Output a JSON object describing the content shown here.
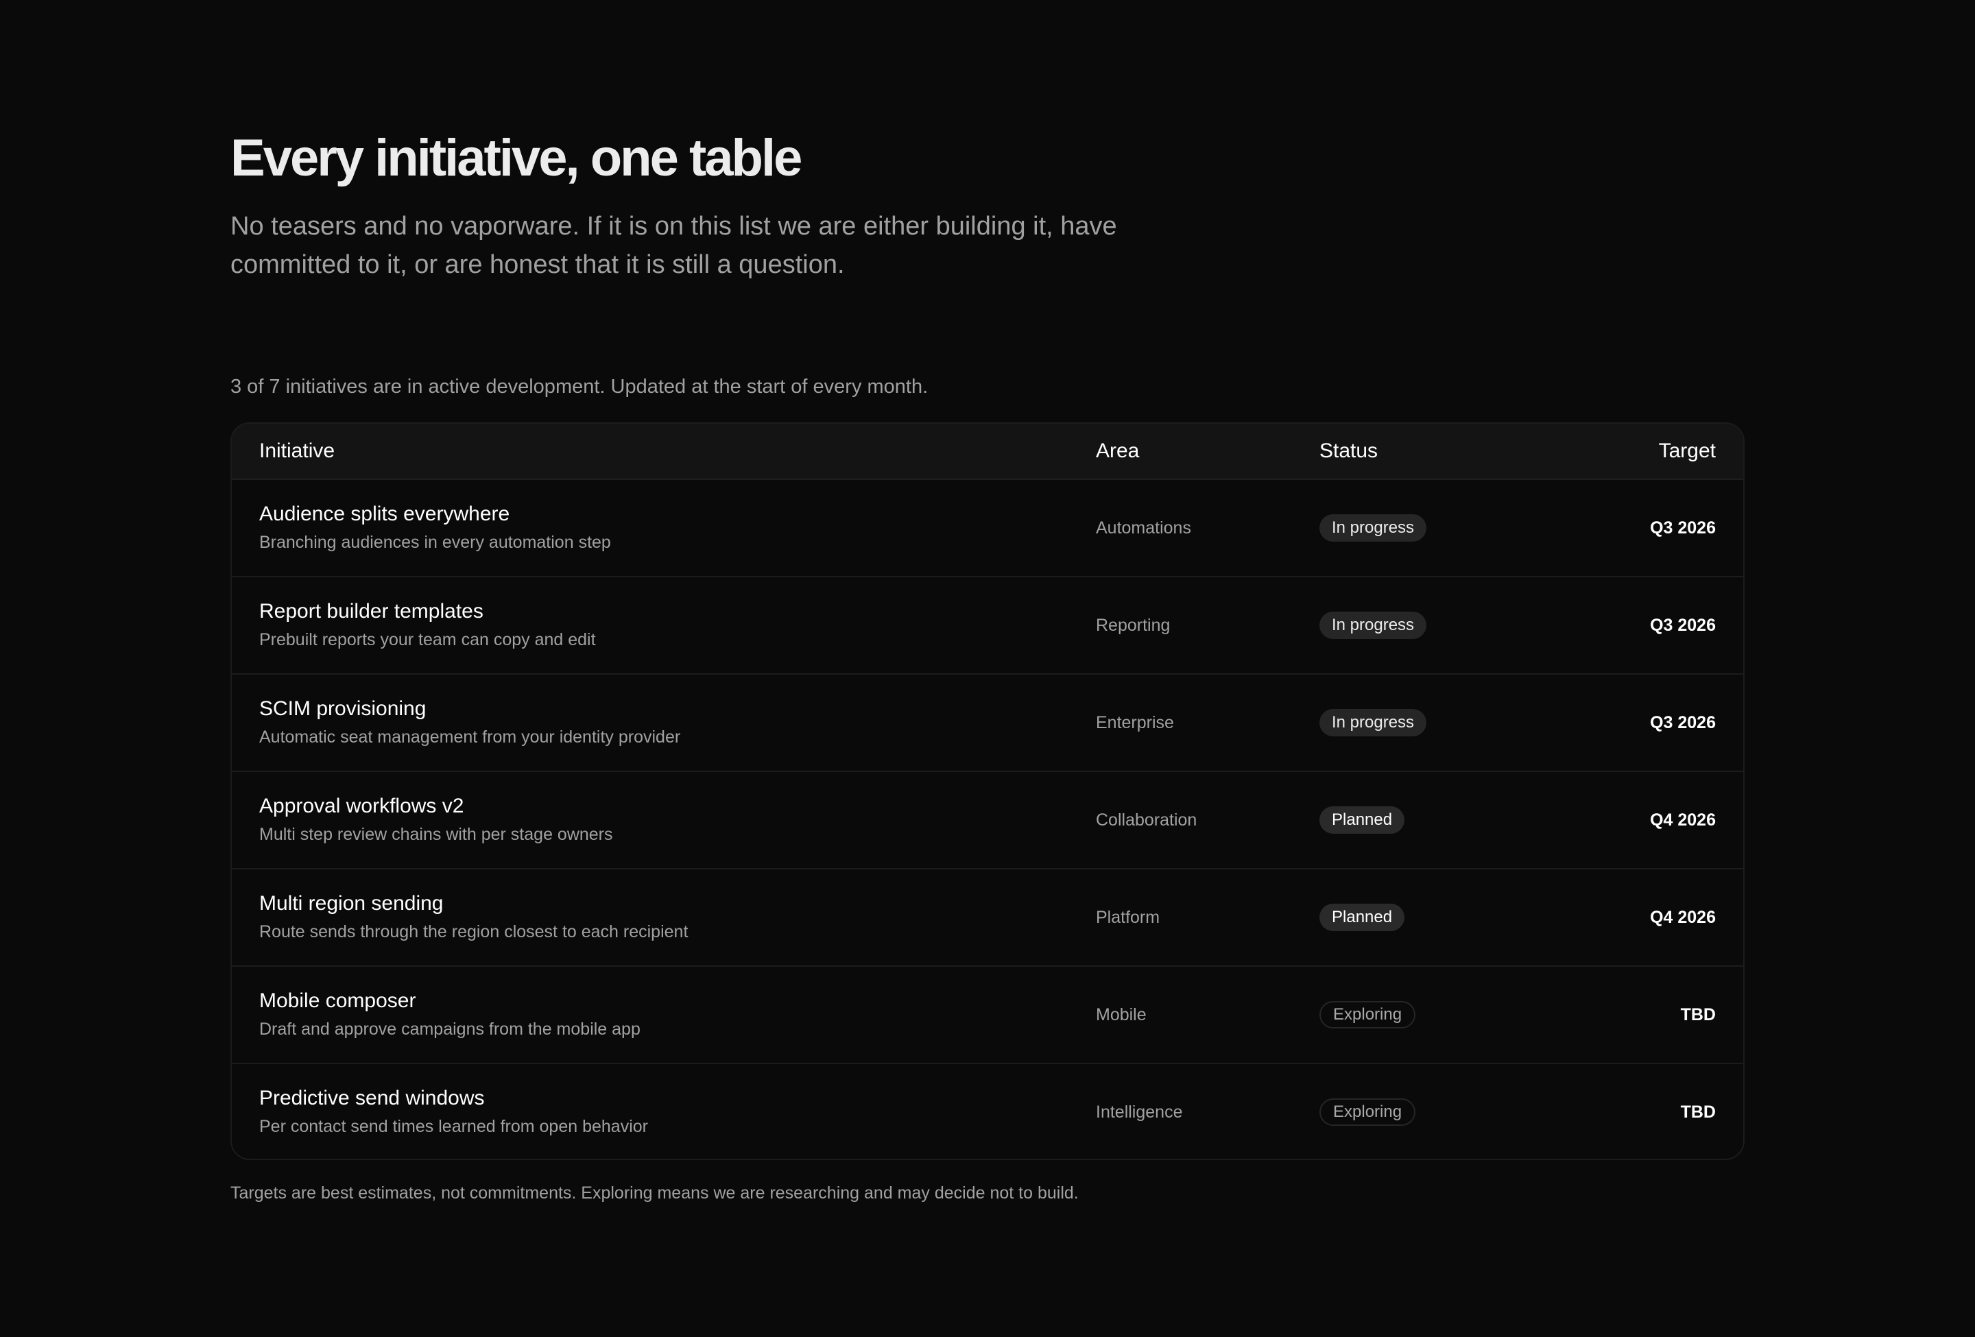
{
  "header": {
    "title": "Every initiative, one table",
    "subtitle": "No teasers and no vaporware. If it is on this list we are either building it, have committed to it, or are honest that it is still a question."
  },
  "summary": "3 of 7 initiatives are in active development. Updated at the start of every month.",
  "table": {
    "columns": {
      "initiative": "Initiative",
      "area": "Area",
      "status": "Status",
      "target": "Target"
    },
    "rows": [
      {
        "name": "Audience splits everywhere",
        "description": "Branching audiences in every automation step",
        "area": "Automations",
        "status": "In progress",
        "status_key": "in-progress",
        "target": "Q3 2026"
      },
      {
        "name": "Report builder templates",
        "description": "Prebuilt reports your team can copy and edit",
        "area": "Reporting",
        "status": "In progress",
        "status_key": "in-progress",
        "target": "Q3 2026"
      },
      {
        "name": "SCIM provisioning",
        "description": "Automatic seat management from your identity provider",
        "area": "Enterprise",
        "status": "In progress",
        "status_key": "in-progress",
        "target": "Q3 2026"
      },
      {
        "name": "Approval workflows v2",
        "description": "Multi step review chains with per stage owners",
        "area": "Collaboration",
        "status": "Planned",
        "status_key": "planned",
        "target": "Q4 2026"
      },
      {
        "name": "Multi region sending",
        "description": "Route sends through the region closest to each recipient",
        "area": "Platform",
        "status": "Planned",
        "status_key": "planned",
        "target": "Q4 2026"
      },
      {
        "name": "Mobile composer",
        "description": "Draft and approve campaigns from the mobile app",
        "area": "Mobile",
        "status": "Exploring",
        "status_key": "exploring",
        "target": "TBD"
      },
      {
        "name": "Predictive send windows",
        "description": "Per contact send times learned from open behavior",
        "area": "Intelligence",
        "status": "Exploring",
        "status_key": "exploring",
        "target": "TBD"
      }
    ]
  },
  "footnote": "Targets are best estimates, not commitments. Exploring means we are researching and may decide not to build.",
  "colors": {
    "background": "#0a0a0a",
    "header_background": "#141414",
    "muted_text": "#a1a1a1",
    "badge_fill": "#262626"
  }
}
